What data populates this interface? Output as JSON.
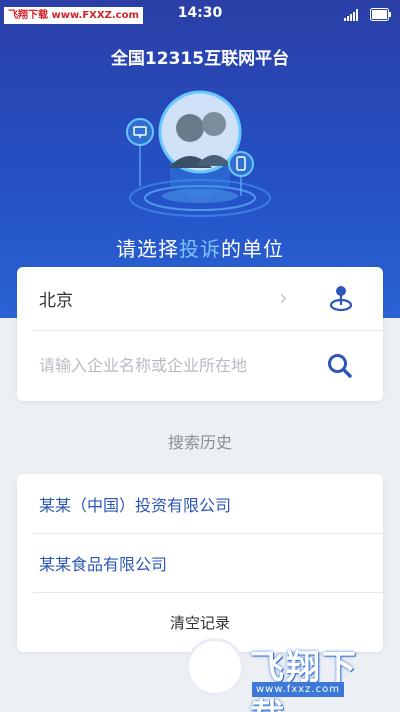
{
  "status_bar": {
    "watermark": "飞翔下载 www.FXXZ.com",
    "time": "14:30"
  },
  "header": {
    "title": "全国12315互联网平台",
    "prompt_before": "请选择",
    "prompt_highlight": "投诉",
    "prompt_after": "的单位"
  },
  "search_card": {
    "city": "北京",
    "placeholder": "请输入企业名称或企业所在地"
  },
  "history": {
    "title": "搜索历史",
    "items": [
      "某某（中国）投资有限公司",
      "某某食品有限公司"
    ],
    "clear_label": "清空记录"
  },
  "watermark": {
    "brand": "飞翔下载",
    "url": "www.fxxz.com"
  },
  "colors": {
    "header_gradient_top": "#2b3fa6",
    "header_gradient_bottom": "#2a63d6",
    "accent": "#2d56b8",
    "highlight": "#7fc3ff"
  },
  "icons": {
    "location": "location-pin-icon",
    "search": "search-icon",
    "chevron": "chevron-right-icon"
  }
}
